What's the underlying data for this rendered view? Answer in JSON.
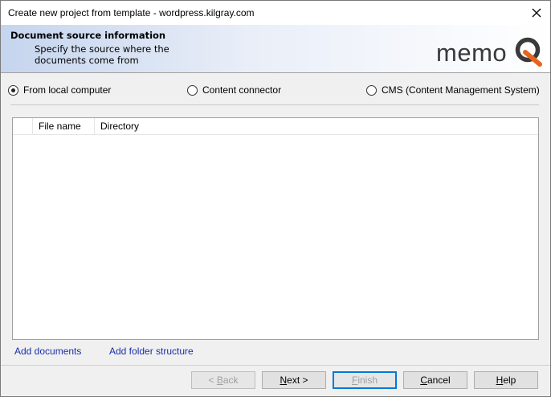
{
  "window": {
    "title": "Create new project from template - wordpress.kilgray.com"
  },
  "banner": {
    "title": "Document source information",
    "subtitle": "Specify the source where the documents come from",
    "logo_text": "memoQ"
  },
  "source_options": [
    {
      "label": "From local computer",
      "selected": true
    },
    {
      "label": "Content connector",
      "selected": false
    },
    {
      "label": "CMS (Content Management System)",
      "selected": false
    }
  ],
  "file_list": {
    "columns": [
      "File name",
      "Directory"
    ],
    "rows": []
  },
  "links": {
    "add_documents": "Add documents",
    "add_folder_structure": "Add folder structure"
  },
  "buttons": {
    "back": {
      "mnemonic": "B",
      "rest": "ack",
      "prefix": "< ",
      "enabled": false
    },
    "next": {
      "mnemonic": "N",
      "rest": "ext >",
      "enabled": true
    },
    "finish": {
      "mnemonic": "F",
      "rest": "inish",
      "enabled": false
    },
    "cancel": {
      "mnemonic": "C",
      "rest": "ancel",
      "enabled": true
    },
    "help": {
      "mnemonic": "H",
      "rest": "elp",
      "enabled": true
    }
  },
  "colors": {
    "link": "#1a2fa8",
    "logo_orange": "#e8641e",
    "logo_text": "#3a3a3a"
  }
}
